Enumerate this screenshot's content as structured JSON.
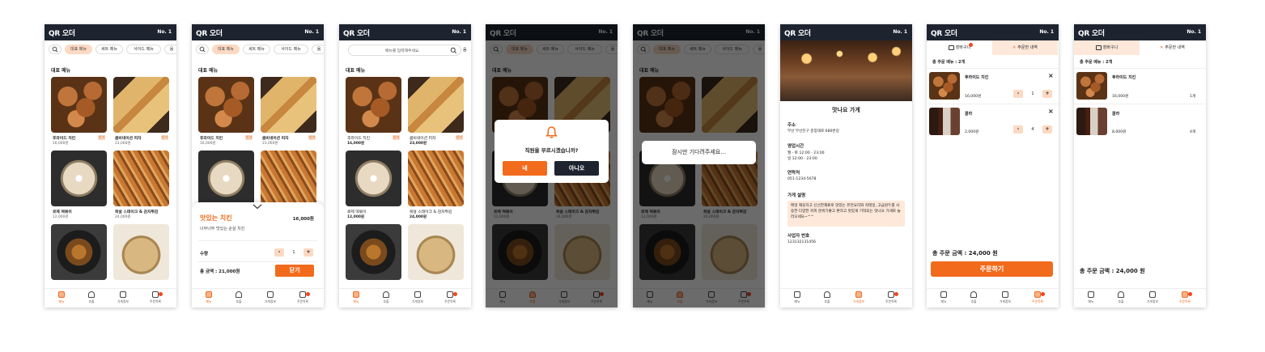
{
  "app": {
    "logo": "QR 오더",
    "table_no": "No. 1"
  },
  "colors": {
    "accent": "#f26b1d",
    "accent_light": "#fbd9c3",
    "header_bg": "#1d2430"
  },
  "categories": [
    "대표 메뉴",
    "세트 메뉴",
    "사이드 메뉴",
    "음"
  ],
  "search": {
    "placeholder": "메뉴를 입력해주세요."
  },
  "section_title": "대표 메뉴",
  "menu_items": [
    {
      "name": "후라이드 치킨",
      "price": "16,000원",
      "badge": "인기"
    },
    {
      "name": "콤비네이션 피자",
      "price": "23,000원",
      "badge": "인기"
    },
    {
      "name": "로제 떡볶이",
      "price": "12,000원",
      "badge": ""
    },
    {
      "name": "목살 스테이크 & 감자튀김",
      "price": "24,000원",
      "badge": ""
    },
    {
      "name": "",
      "price": "",
      "badge": ""
    },
    {
      "name": "",
      "price": "",
      "badge": ""
    }
  ],
  "nav": {
    "menu": "메뉴",
    "call": "호출",
    "store_info": "가게정보",
    "order_list": "주문목록"
  },
  "detail_sheet": {
    "name": "맛있는 치킨",
    "price": "16,000원",
    "desc": "너무너무 맛있는 순살 치킨",
    "qty_label": "수량",
    "qty_minus": "-",
    "qty_value": "1",
    "qty_plus": "+",
    "total": "총 금액 : 21,000원",
    "close": "닫기"
  },
  "call_modal": {
    "question": "직원을 부르시겠습니까?",
    "yes": "네",
    "no": "아니오"
  },
  "wait_modal": {
    "text": "잠시만 기다려주세요..."
  },
  "store": {
    "name": "맛나요 가게",
    "address_label": "주소",
    "address": "부산 부산진구 중앙대로 680번길",
    "hours_label": "영업시간",
    "hours_1": "월 - 토 12:00 - 23:00",
    "hours_2": "일 12:00 - 23:00",
    "contact_label": "연락처",
    "contact": "051-1234-5678",
    "desc_label": "가게 설명",
    "desc": "매일 깨끗하고 신선한재료로 맛있는 퓨전요리와 칵테일, 고급원두를 사용한 다양한 커피 분위기좋고 편하고 맛있게 기억되는 맛나요 가게로 놀러오세요~^^",
    "biz_label": "사업자 번호",
    "biz_no": "123132131456"
  },
  "cart": {
    "tab_cart": "장바구니",
    "tab_history": "주문한 내역",
    "summary": "총 주문 메뉴 : 2개",
    "items": [
      {
        "name": "후라이드 치킨",
        "price": "16,000원",
        "qty": "1",
        "count": "1개"
      },
      {
        "name": "콜라",
        "price": "2,000원",
        "qty": "4",
        "count": "4개"
      }
    ],
    "history_prices": [
      "16,000원",
      "8,000원"
    ],
    "remove": "×",
    "minus": "-",
    "plus": "+",
    "total": "총 주문 금액 : 24,000 원",
    "order_button": "주문하기"
  }
}
